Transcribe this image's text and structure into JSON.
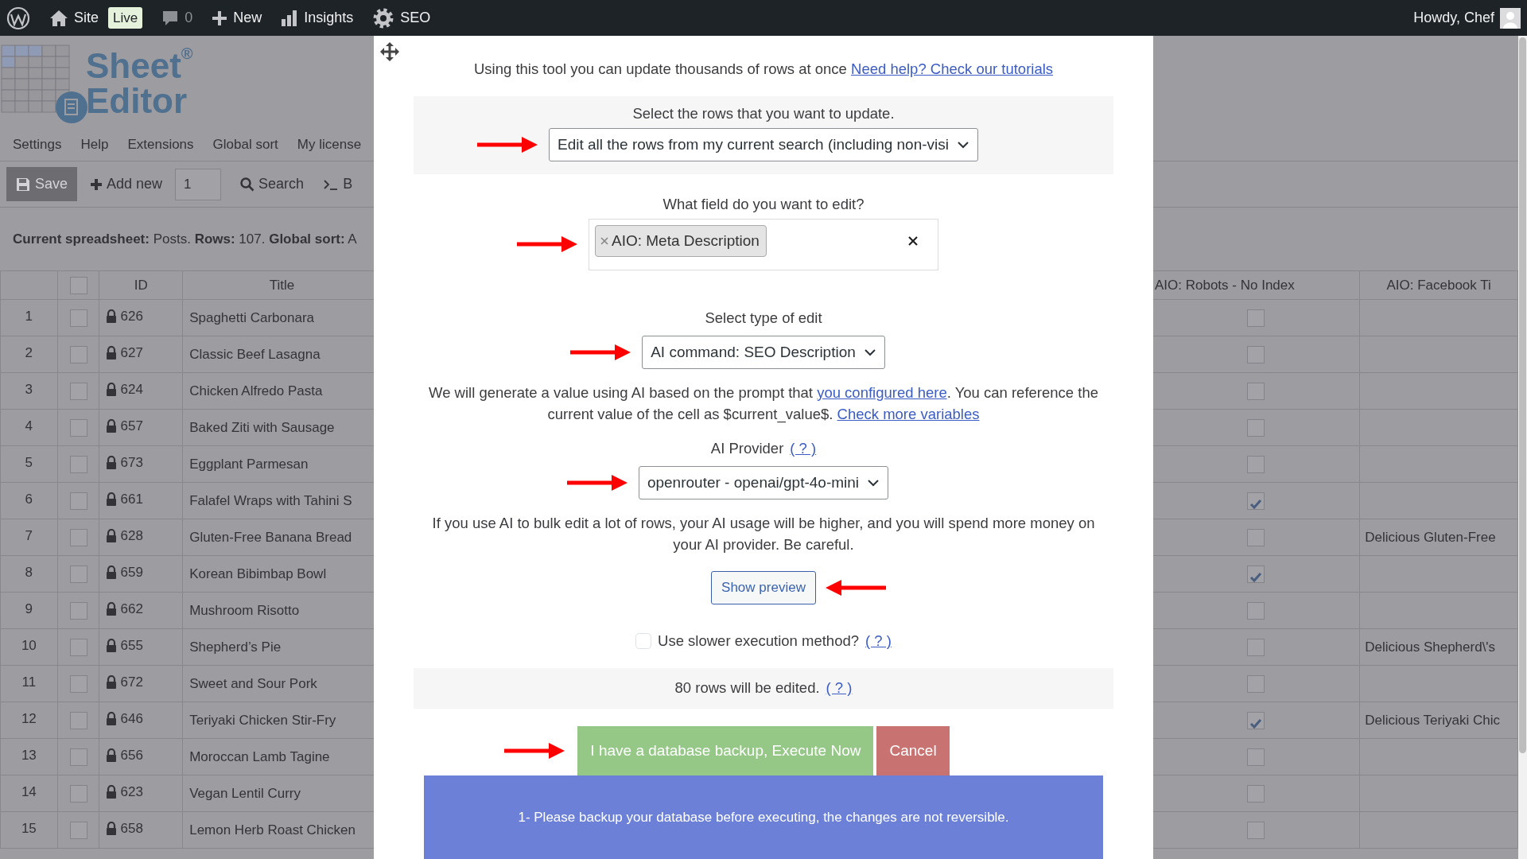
{
  "admin_bar": {
    "items": [
      {
        "kind": "wordpress"
      },
      {
        "kind": "home",
        "label": "Site"
      },
      {
        "kind": "badge",
        "label": "Live"
      },
      {
        "kind": "comments",
        "label": "0"
      },
      {
        "kind": "new",
        "label": "New"
      },
      {
        "kind": "insights",
        "label": "Insights"
      },
      {
        "kind": "seo",
        "label": "SEO"
      }
    ],
    "greeting": "Howdy, Chef"
  },
  "logo": {
    "line1": "Sheet",
    "mark": "®",
    "line2": "Editor"
  },
  "menu": [
    "Settings",
    "Help",
    "Extensions",
    "Global sort",
    "My license"
  ],
  "toolbar": {
    "save": "Save",
    "add_new": "Add new",
    "count_value": "1",
    "search": "Search",
    "more": "B"
  },
  "summary": "**Current spreadsheet:** Posts. **Rows:** 107. **Global sort:** A",
  "table": {
    "select_all_checked": false,
    "columns": [
      "ID",
      "Title"
    ],
    "right_columns": [
      "AIO: Robots - No Index",
      "AIO: Facebook Ti"
    ],
    "rows": [
      {
        "number": "1",
        "checked": false,
        "locked": true,
        "id": "626",
        "title": "Spaghetti Carbonara",
        "no_index": false
      },
      {
        "number": "2",
        "checked": false,
        "locked": true,
        "id": "627",
        "title": "Classic Beef Lasagna",
        "no_index": false
      },
      {
        "number": "3",
        "checked": false,
        "locked": true,
        "id": "624",
        "title": "Chicken Alfredo Pasta",
        "no_index": false
      },
      {
        "number": "4",
        "checked": false,
        "locked": true,
        "id": "657",
        "title": "Baked Ziti with Sausage",
        "no_index": false
      },
      {
        "number": "5",
        "checked": false,
        "locked": true,
        "id": "673",
        "title": "Eggplant Parmesan",
        "no_index": false
      },
      {
        "number": "6",
        "checked": false,
        "locked": true,
        "id": "661",
        "title": "Falafel Wraps with Tahini S",
        "no_index": true
      },
      {
        "number": "7",
        "checked": false,
        "locked": true,
        "id": "628",
        "title": "Gluten-Free Banana Bread",
        "no_index": false,
        "facebook_title": "Delicious Gluten-Free"
      },
      {
        "number": "8",
        "checked": false,
        "locked": true,
        "id": "659",
        "title": "Korean Bibimbap Bowl",
        "no_index": true
      },
      {
        "number": "9",
        "checked": false,
        "locked": true,
        "id": "662",
        "title": "Mushroom Risotto",
        "no_index": false
      },
      {
        "number": "10",
        "checked": false,
        "locked": true,
        "id": "655",
        "title": "Shepherd’s Pie",
        "no_index": false,
        "facebook_title": "Delicious Shepherd\\'s"
      },
      {
        "number": "11",
        "checked": false,
        "locked": true,
        "id": "672",
        "title": "Sweet and Sour Pork",
        "no_index": false
      },
      {
        "number": "12",
        "checked": false,
        "locked": true,
        "id": "646",
        "title": "Teriyaki Chicken Stir-Fry",
        "no_index": true,
        "facebook_title": "Delicious Teriyaki Chic"
      },
      {
        "number": "13",
        "checked": false,
        "locked": true,
        "id": "656",
        "title": "Moroccan Lamb Tagine",
        "no_index": false
      },
      {
        "number": "14",
        "checked": false,
        "locked": true,
        "id": "623",
        "title": "Vegan Lentil Curry",
        "no_index": false
      },
      {
        "number": "15",
        "checked": false,
        "locked": true,
        "id": "658",
        "title": "Lemon Herb Roast Chicken",
        "no_index": false
      }
    ]
  },
  "modal": {
    "intro": "Using this tool you can update thousands of rows at once",
    "intro_link": "Need help? Check our tutorials",
    "rows_label": "Select the rows that you want to update.",
    "rows_value": "Edit all the rows from my current search (including non-visi",
    "field_label": "What field do you want to edit?",
    "field_tags": [
      {
        "label": "AIO: Meta Description"
      }
    ],
    "edit_type_label": "Select type of edit",
    "edit_type_value": "AI command: SEO Description",
    "ai_note": [
      {
        "text": "We will generate a value using AI based on the prompt that "
      },
      {
        "link": "you configured here"
      },
      {
        "text": ". You can reference the current value of the cell as $current_value$. "
      },
      {
        "link": "Check more variables"
      }
    ],
    "provider_label": "AI Provider",
    "provider_help": "( ? )",
    "provider_value": "openrouter - openai/gpt-4o-mini",
    "cost_note": "If you use AI to bulk edit a lot of rows, your AI usage will be higher, and you will spend more money on your AI provider. Be careful.",
    "preview_button": "Show preview",
    "slower": {
      "label": "Use slower execution method?",
      "checked": false,
      "help": "( ? )"
    },
    "count_note": "80 rows will be edited.",
    "count_help": "( ? )",
    "execute_button": "I have a database backup, Execute Now",
    "cancel_button": "Cancel",
    "warning": "1- Please backup your database before executing, the changes are not reversible."
  }
}
